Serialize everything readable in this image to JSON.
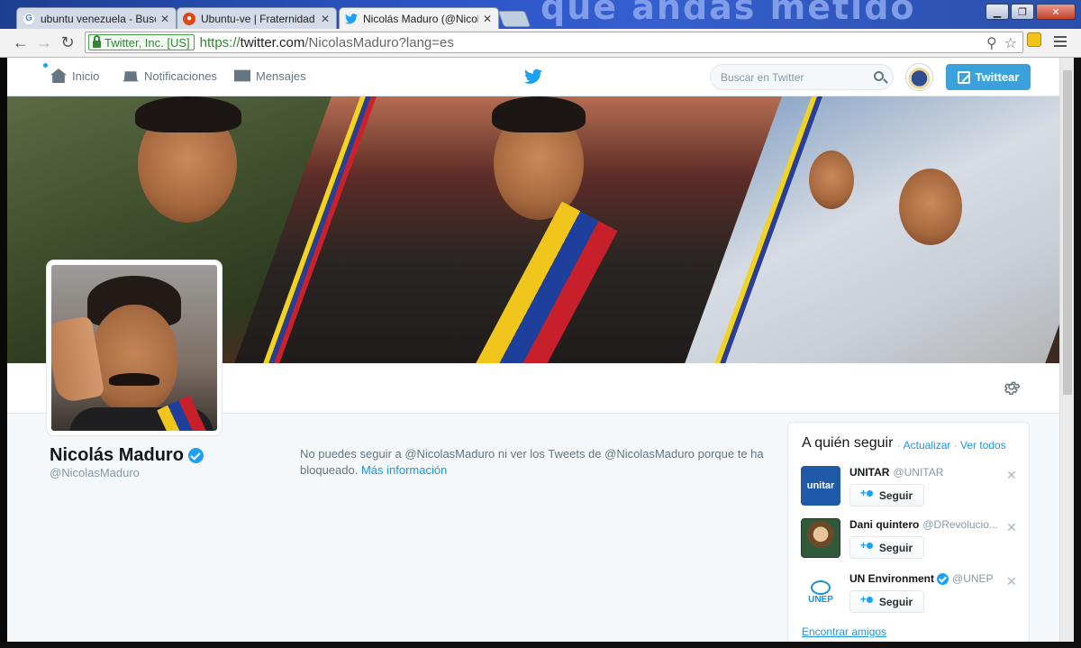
{
  "browser": {
    "tabs": [
      {
        "title": "ubuntu venezuela - Busca",
        "favicon": "google-g-icon"
      },
      {
        "title": "Ubuntu-ve | Fraternidad U",
        "favicon": "ubuntu-icon"
      },
      {
        "title": "Nicolás Maduro (@Nicola",
        "favicon": "twitter-bird-icon",
        "active": true
      }
    ],
    "wallpaper_text": "que andas metido",
    "ev_label": "Twitter, Inc. [US]",
    "url_scheme": "https://",
    "url_host": "twitter.com",
    "url_path": "/NicolasMaduro?lang=es"
  },
  "nav": {
    "home": "Inicio",
    "notifications": "Notificaciones",
    "messages": "Mensajes",
    "search_placeholder": "Buscar en Twitter",
    "tweet_button": "Twittear"
  },
  "profile": {
    "name": "Nicolás Maduro",
    "handle": "@NicolasMaduro",
    "verified": true
  },
  "blocked": {
    "message": "No puedes seguir a @NicolasMaduro ni ver los Tweets de @NicolasMaduro porque te ha bloqueado.",
    "link": "Más información"
  },
  "who_to_follow": {
    "title": "A quién seguir",
    "sep": " · ",
    "refresh": "Actualizar",
    "view_all": "Ver todos",
    "follow_label": "Seguir",
    "suggestions": [
      {
        "name": "UNITAR",
        "handle": "@UNITAR",
        "verified": false,
        "avatar_text": "unitar"
      },
      {
        "name": "Dani quintero",
        "handle": "@DRevolucio...",
        "verified": false,
        "avatar_text": ""
      },
      {
        "name": "UN Environment",
        "handle": "@UNEP",
        "verified": true,
        "avatar_text": "UNEP"
      }
    ],
    "find_friends": "Encontrar amigos"
  },
  "colors": {
    "twitter_blue": "#1da1f2",
    "tweet_button": "#3ba1da",
    "page_bg": "#f5f8fa"
  }
}
